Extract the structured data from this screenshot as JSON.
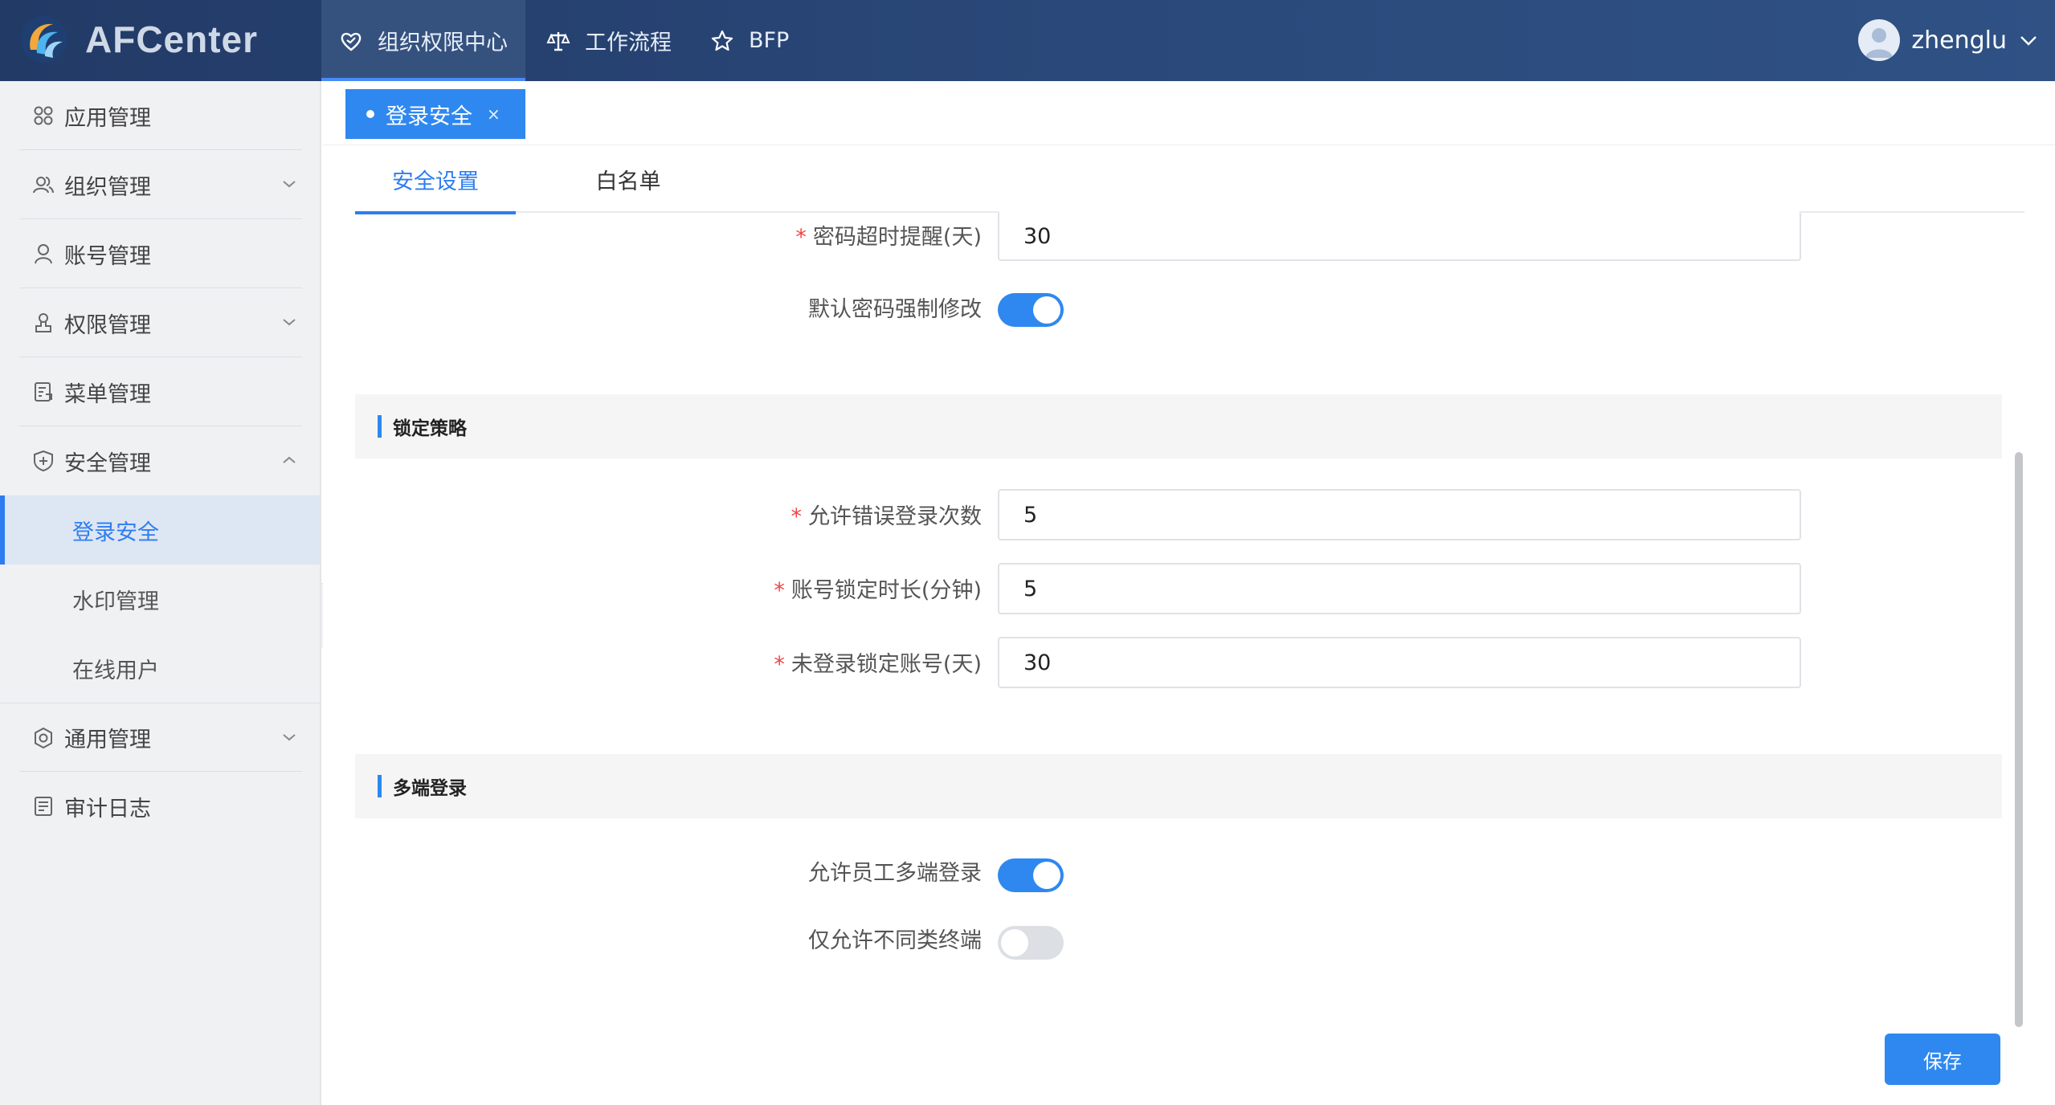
{
  "app": {
    "name": "AFCenter"
  },
  "nav": {
    "items": [
      {
        "label": "组织权限中心",
        "icon": "heart-shield-icon",
        "active": true
      },
      {
        "label": "工作流程",
        "icon": "scale-icon",
        "active": false
      },
      {
        "label": "BFP",
        "icon": "star-icon",
        "active": false
      }
    ]
  },
  "user": {
    "name": "zhenglu"
  },
  "sidebar": {
    "items": [
      {
        "label": "应用管理",
        "icon": "grid-icon"
      },
      {
        "label": "组织管理",
        "icon": "users-icon"
      },
      {
        "label": "账号管理",
        "icon": "user-icon"
      },
      {
        "label": "权限管理",
        "icon": "permission-icon"
      },
      {
        "label": "菜单管理",
        "icon": "menu-doc-icon"
      },
      {
        "label": "安全管理",
        "icon": "shield-plus-icon"
      },
      {
        "label": "通用管理",
        "icon": "settings-icon"
      },
      {
        "label": "审计日志",
        "icon": "log-icon"
      }
    ],
    "security_sub": [
      {
        "label": "登录安全",
        "active": true
      },
      {
        "label": "水印管理",
        "active": false
      },
      {
        "label": "在线用户",
        "active": false
      }
    ]
  },
  "page_tab": {
    "label": "登录安全",
    "close": "×"
  },
  "sub_tabs": [
    {
      "label": "安全设置",
      "active": true
    },
    {
      "label": "白名单",
      "active": false
    }
  ],
  "password": {
    "timeout_label": "密码超时提醒(天)",
    "timeout_value": "30",
    "force_change_label": "默认密码强制修改",
    "force_change_on": true
  },
  "lock": {
    "section_title": "锁定策略",
    "attempts_label": "允许错误登录次数",
    "attempts_value": "5",
    "duration_label": "账号锁定时长(分钟)",
    "duration_value": "5",
    "inactive_label": "未登录锁定账号(天)",
    "inactive_value": "30"
  },
  "multi": {
    "section_title": "多端登录",
    "allow_label": "允许员工多端登录",
    "allow_on": true,
    "diff_label": "仅允许不同类终端",
    "diff_on": false
  },
  "required_mark": "*",
  "save_label": "保存",
  "colors": {
    "primary": "#2e88f0",
    "header": "#2b4a7c",
    "required": "#f04545"
  }
}
